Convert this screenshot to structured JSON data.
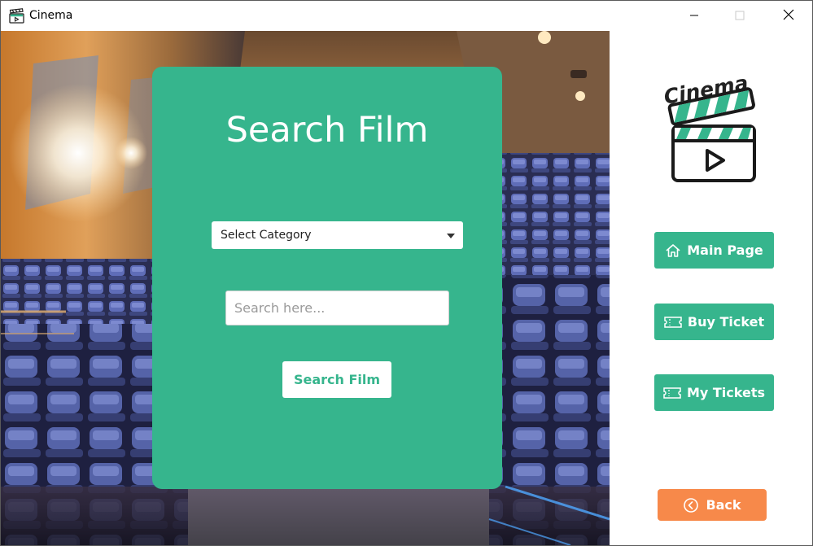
{
  "window": {
    "title": "Cinema",
    "icons": {
      "app": "clapperboard-icon",
      "minimize": "minimize-icon",
      "maximize": "maximize-icon",
      "close": "close-icon"
    }
  },
  "search": {
    "heading": "Search Film",
    "category_select": {
      "value": "Select Category",
      "icon": "caret-down-icon"
    },
    "search_input": {
      "placeholder": "Search here...",
      "value": ""
    },
    "submit_label": "Search Film"
  },
  "sidebar": {
    "logo_text": "Cinema",
    "nav": [
      {
        "label": "Main Page",
        "icon": "home-icon"
      },
      {
        "label": "Buy Ticket",
        "icon": "ticket-icon"
      },
      {
        "label": "My Tickets",
        "icon": "ticket-icon"
      }
    ],
    "back_label": "Back",
    "back_icon": "chevron-left-circle-icon"
  },
  "colors": {
    "accent_green": "#36b58d",
    "back_orange": "#f7894a",
    "white": "#ffffff"
  }
}
